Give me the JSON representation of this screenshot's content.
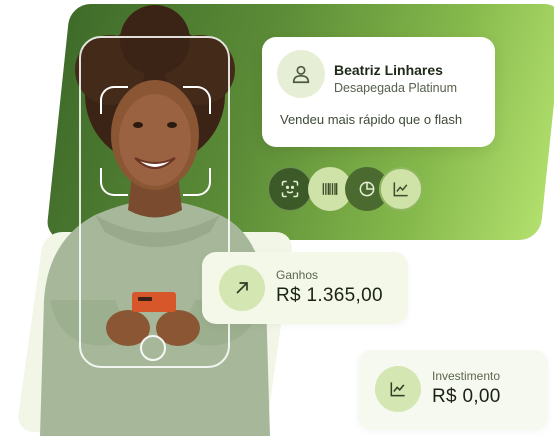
{
  "profile": {
    "name": "Beatriz Linhares",
    "subtitle": "Desapegada Platinum",
    "quote": "Vendeu mais rápido que o flash",
    "avatar_icon": "user-icon"
  },
  "action_icons": [
    {
      "icon": "face-scan-icon"
    },
    {
      "icon": "barcode-icon"
    },
    {
      "icon": "pie-chart-icon"
    },
    {
      "icon": "trend-chart-icon"
    }
  ],
  "stats": {
    "gains": {
      "label": "Ganhos",
      "value": "R$ 1.365,00",
      "icon": "arrow-up-right-icon"
    },
    "investment": {
      "label": "Investimento",
      "value": "R$ 0,00",
      "icon": "trend-chart-icon"
    }
  },
  "colors": {
    "brand_green_dark": "#3f6b2a",
    "brand_green_light": "#b3e06e",
    "card_tint": "#f4f8e8",
    "icon_tint": "#d4e6b1"
  }
}
